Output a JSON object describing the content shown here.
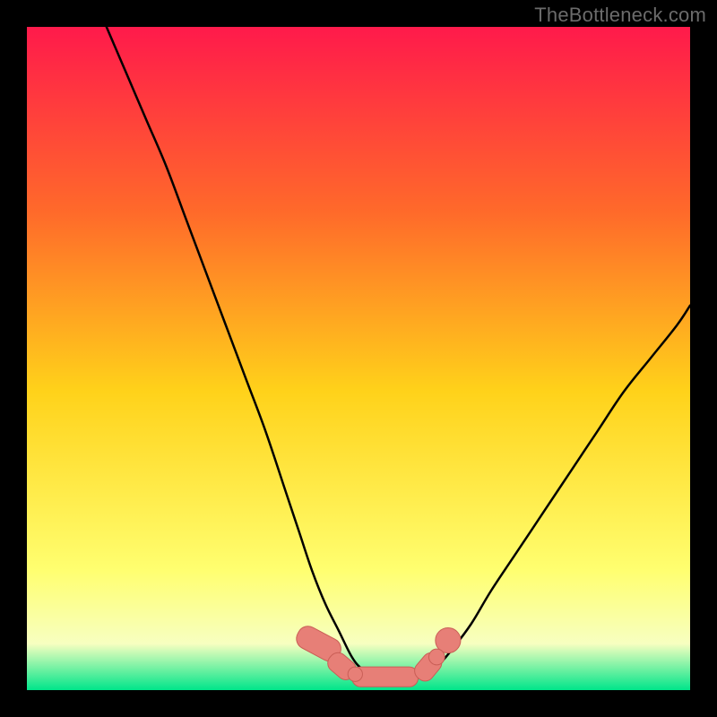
{
  "watermark": "TheBottleneck.com",
  "colors": {
    "frame": "#000000",
    "gradient_top": "#ff1a4b",
    "gradient_mid1": "#ff6a2a",
    "gradient_mid2": "#ffd21a",
    "gradient_mid3": "#ffff70",
    "gradient_mid4": "#f7ffc0",
    "gradient_bottom": "#00e58a",
    "curve": "#000000",
    "marker_fill": "#e77f77",
    "marker_stroke": "#c95e56"
  },
  "chart_data": {
    "type": "line",
    "title": "",
    "xlabel": "",
    "ylabel": "",
    "xlim": [
      0,
      100
    ],
    "ylim": [
      0,
      100
    ],
    "series": [
      {
        "name": "left-curve",
        "x": [
          12,
          15,
          18,
          21,
          24,
          27,
          30,
          33,
          36,
          39,
          41,
          43,
          45,
          47,
          49,
          50.5,
          52
        ],
        "y": [
          100,
          93,
          86,
          79,
          71,
          63,
          55,
          47,
          39,
          30,
          24,
          18,
          13,
          9,
          5,
          3.2,
          2.4
        ]
      },
      {
        "name": "right-curve",
        "x": [
          60,
          62,
          64,
          67,
          70,
          74,
          78,
          82,
          86,
          90,
          94,
          98,
          100
        ],
        "y": [
          2.6,
          3.8,
          6,
          10,
          15,
          21,
          27,
          33,
          39,
          45,
          50,
          55,
          58
        ]
      },
      {
        "name": "valley-floor",
        "x": [
          49,
          51,
          53,
          55,
          57,
          59,
          60.5
        ],
        "y": [
          3.0,
          2.2,
          1.9,
          1.9,
          2.0,
          2.2,
          2.6
        ]
      }
    ],
    "markers": [
      {
        "shape": "round-rect",
        "cx": 44.0,
        "cy": 7.0,
        "w": 3.5,
        "h": 7.0,
        "angle": -62
      },
      {
        "shape": "round-rect",
        "cx": 47.5,
        "cy": 3.6,
        "w": 3.0,
        "h": 4.5,
        "angle": -50
      },
      {
        "shape": "round-rect",
        "cx": 54.0,
        "cy": 2.0,
        "w": 10.0,
        "h": 3.0,
        "angle": 0
      },
      {
        "shape": "round-rect",
        "cx": 60.5,
        "cy": 3.5,
        "w": 3.0,
        "h": 4.5,
        "angle": 40
      },
      {
        "shape": "circle",
        "cx": 63.5,
        "cy": 7.5,
        "r": 1.9
      },
      {
        "shape": "circle",
        "cx": 61.8,
        "cy": 5.0,
        "r": 1.2
      },
      {
        "shape": "circle",
        "cx": 49.5,
        "cy": 2.4,
        "r": 1.1
      }
    ]
  }
}
